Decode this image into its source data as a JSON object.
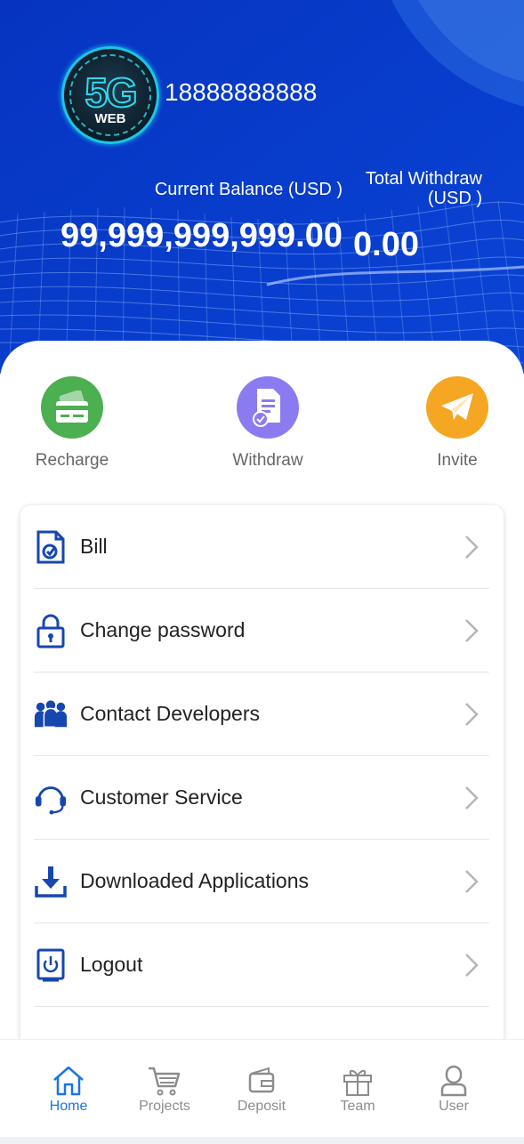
{
  "profile": {
    "phone": "18888888888",
    "avatar_text_main": "5G",
    "avatar_text_sub": "WEB"
  },
  "balance": {
    "current_label": "Current Balance (USD )",
    "current_value": "99,999,999,999.00",
    "withdraw_label_line1": "Total Withdraw",
    "withdraw_label_line2": "(USD )",
    "withdraw_value": "0.00"
  },
  "quick_actions": [
    {
      "label": "Recharge",
      "icon": "credit-card-icon",
      "color": "#4caf50"
    },
    {
      "label": "Withdraw",
      "icon": "document-check-icon",
      "color": "#8a7cf0"
    },
    {
      "label": "Invite",
      "icon": "paper-plane-icon",
      "color": "#f5a623"
    }
  ],
  "menu": [
    {
      "label": "Bill",
      "icon": "bill-icon"
    },
    {
      "label": "Change password",
      "icon": "lock-icon"
    },
    {
      "label": "Contact Developers",
      "icon": "people-icon"
    },
    {
      "label": "Customer Service",
      "icon": "headset-icon"
    },
    {
      "label": "Downloaded Applications",
      "icon": "download-icon"
    },
    {
      "label": "Logout",
      "icon": "power-icon"
    }
  ],
  "bottom_nav": [
    {
      "label": "Home",
      "icon": "home-icon",
      "active": true
    },
    {
      "label": "Projects",
      "icon": "cart-icon",
      "active": false
    },
    {
      "label": "Deposit",
      "icon": "wallet-icon",
      "active": false
    },
    {
      "label": "Team",
      "icon": "gift-icon",
      "active": false
    },
    {
      "label": "User",
      "icon": "user-icon",
      "active": false
    }
  ],
  "colors": {
    "header_bg": "#0a3cc8",
    "menu_icon": "#1647b0",
    "nav_active": "#1a73e8",
    "nav_inactive": "#8c8c8c"
  }
}
